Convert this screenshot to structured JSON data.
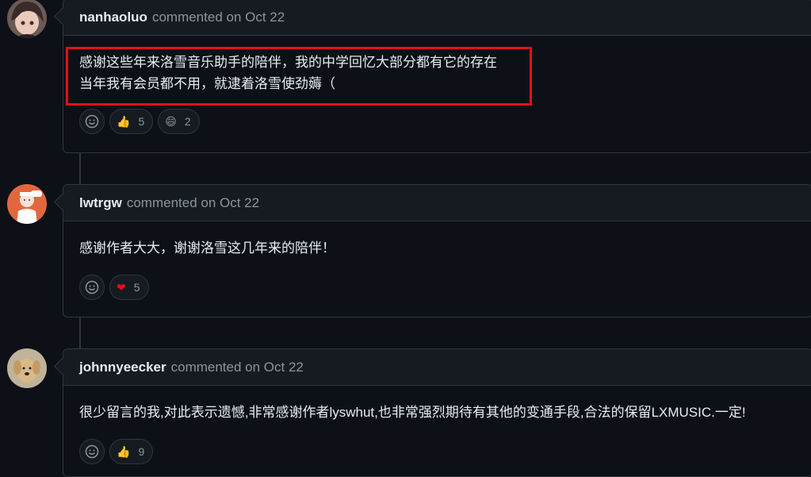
{
  "comments": [
    {
      "author": "nanhaoluo",
      "meta": "commented on Oct 22",
      "body_lines": [
        "感谢这些年来洛雪音乐助手的陪伴，我的中学回忆大部分都有它的存在",
        "当年我有会员都不用，就逮着洛雪使劲薅（"
      ],
      "reactions": [
        {
          "icon": "thumbs-up-icon",
          "glyph": "👍",
          "count": "5"
        },
        {
          "icon": "laugh-icon",
          "glyph": "😄",
          "count": "2"
        }
      ]
    },
    {
      "author": "lwtrgw",
      "meta": "commented on Oct 22",
      "body_lines": [
        "感谢作者大大，谢谢洛雪这几年来的陪伴！"
      ],
      "reactions": [
        {
          "icon": "heart-icon",
          "glyph": "❤",
          "count": "5"
        }
      ]
    },
    {
      "author": "johnnyeecker",
      "meta": "commented on Oct 22",
      "body_lines": [
        "很少留言的我,对此表示遗憾,非常感谢作者lyswhut,也非常强烈期待有其他的变通手段,合法的保留LXMUSIC.一定!"
      ],
      "reactions": [
        {
          "icon": "thumbs-up-icon",
          "glyph": "👍",
          "count": "9"
        }
      ]
    }
  ],
  "colors": {
    "background": "#0d1117",
    "header": "#161b22",
    "border": "#30363d",
    "highlight": "#e3101a",
    "muted": "#8b949e"
  }
}
